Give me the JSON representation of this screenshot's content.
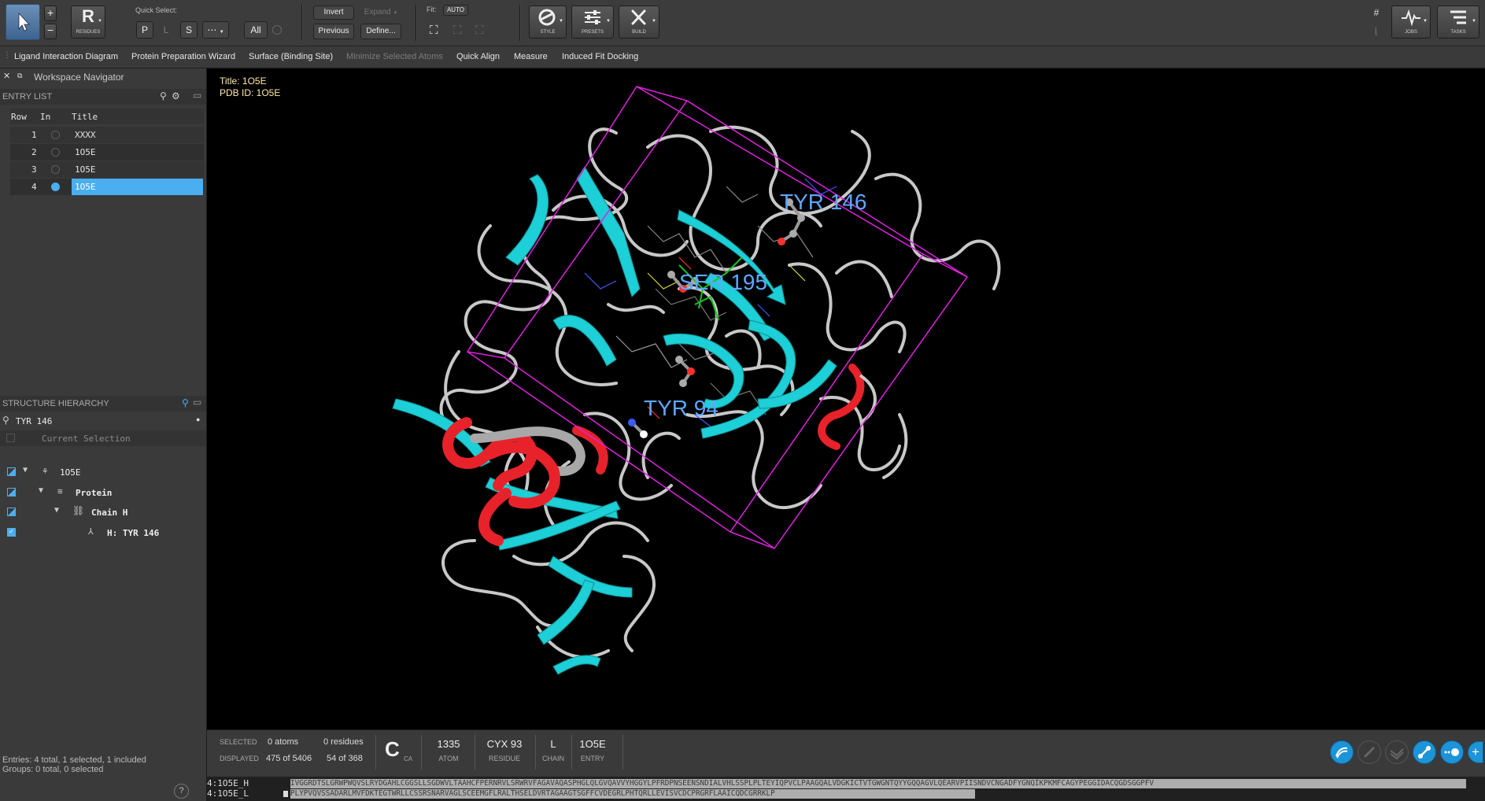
{
  "toolbar": {
    "residues_letter": "R",
    "residues_label": "RESIDUES",
    "quick_select_label": "Quick Select:",
    "qs_buttons": [
      "P",
      "L",
      "S"
    ],
    "qs_more": "⋯",
    "all_label": "All",
    "invert_label": "Invert",
    "expand_label": "Expand",
    "previous_label": "Previous",
    "define_label": "Define...",
    "fit_label": "Fit:",
    "auto_label": "AUTO",
    "style_label": "STYLE",
    "presets_label": "PRESETS",
    "build_label": "BUILD",
    "jobs_label": "JOBS",
    "tasks_label": "TASKS"
  },
  "secbar": {
    "items": [
      {
        "label": "Ligand Interaction Diagram",
        "enabled": true
      },
      {
        "label": "Protein Preparation Wizard",
        "enabled": true
      },
      {
        "label": "Surface (Binding Site)",
        "enabled": true
      },
      {
        "label": "Minimize Selected Atoms",
        "enabled": false
      },
      {
        "label": "Quick Align",
        "enabled": true
      },
      {
        "label": "Measure",
        "enabled": true
      },
      {
        "label": "Induced Fit Docking",
        "enabled": true
      }
    ]
  },
  "workspace_navigator": {
    "title": "Workspace Navigator"
  },
  "entry_list": {
    "header": "ENTRY LIST",
    "columns": [
      "Row",
      "In",
      "Title"
    ],
    "rows": [
      {
        "row": "1",
        "title": "XXXX",
        "included": false,
        "selected": false
      },
      {
        "row": "2",
        "title": "1O5E",
        "included": false,
        "selected": false
      },
      {
        "row": "3",
        "title": "1O5E",
        "included": false,
        "selected": false
      },
      {
        "row": "4",
        "title": "1O5E",
        "included": true,
        "selected": true
      }
    ]
  },
  "structure_hierarchy": {
    "header": "STRUCTURE HIERARCHY",
    "search_value": "TYR 146",
    "current_selection": "Current Selection",
    "tree": [
      {
        "label": "1O5E",
        "icon": "molecule-icon"
      },
      {
        "label": "Protein",
        "icon": "protein-icon"
      },
      {
        "label": "Chain H",
        "icon": "chain-link-icon"
      },
      {
        "label": "H: TYR 146",
        "icon": "residue-icon"
      }
    ]
  },
  "left_footer": {
    "entries": "Entries: 4 total, 1 selected, 1 included",
    "groups": "Groups: 0 total, 0 selected"
  },
  "viewport": {
    "title_line": "Title: 1O5E",
    "pdb_line": "PDB ID: 1O5E",
    "residue_labels": [
      "TYR 146",
      "SER 195",
      "TYR 94"
    ]
  },
  "status": {
    "selected_caption": "SELECTED",
    "selected_atoms": "0 atoms",
    "selected_residues": "0 residues",
    "displayed_caption": "DISPLAYED",
    "displayed_atoms": "475 of 5406",
    "displayed_residues": "54 of 368",
    "atom_element": "C",
    "atom_name": "CA",
    "atom_number": "1335",
    "atom_caption": "ATOM",
    "residue_value": "CYX 93",
    "residue_caption": "RESIDUE",
    "chain_value": "L",
    "chain_caption": "CHAIN",
    "entry_value": "1O5E",
    "entry_caption": "ENTRY"
  },
  "sequence": {
    "rows": [
      {
        "label": "4:1O5E_H",
        "seq": "IVGGRDTSLGRWPWQVSLRYDGAHLCGGSLLSGDWVLTAAHCFPERNRVLSRWRVFAGAVAQASPHGLQLGVQAVVYHGGYLPFRDPNSEENSNDIALVHLSSPLPLTEYIQPVCLPAAGQALVDGKICTVTGWGNTQYYGQQAGVLQEARVPIISNDVCNGADFYGNQIKPKMFCAGYPEGGIDACQGDSGGPFV"
      },
      {
        "label": "4:1O5E_L",
        "seq": "PLYPVQVSSADARLMVFDKTEGTWRLLCSSRSNARVAGLSCEEMGFLRALTHSELDVRTAGAAGTSGFFCVDEGRLPHTQRLLEVISVCDCPRGRFLAAICQDCGRRKLP"
      }
    ]
  },
  "colors": {
    "helix": "#e8222a",
    "strand": "#1dcfd6",
    "box": "#dd22dd",
    "label": "#5ea8ff",
    "accent": "#1d93d8"
  }
}
